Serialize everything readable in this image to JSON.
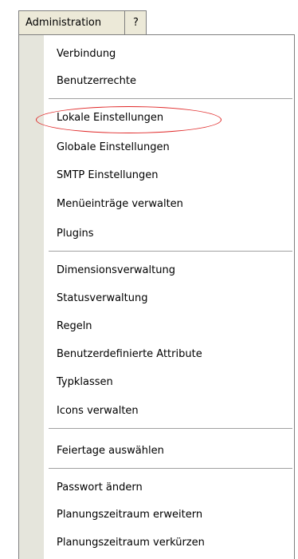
{
  "menubar": {
    "tabs": [
      "Administration",
      "?"
    ]
  },
  "menu": {
    "group1": [
      "Verbindung",
      "Benutzerrechte"
    ],
    "group2": [
      "Lokale Einstellungen",
      "Globale Einstellungen",
      "SMTP Einstellungen",
      "Menüeinträge verwalten",
      "Plugins"
    ],
    "group3": [
      "Dimensionsverwaltung",
      "Statusverwaltung",
      "Regeln",
      "Benutzerdefinierte Attribute",
      "Typklassen",
      "Icons verwalten"
    ],
    "group4": [
      "Feiertage auswählen"
    ],
    "group5": [
      "Passwort ändern",
      "Planungszeitraum erweitern",
      "Planungszeitraum verkürzen"
    ]
  },
  "colors": {
    "highlight": "#e02828",
    "gutter": "#e5e5dc"
  }
}
